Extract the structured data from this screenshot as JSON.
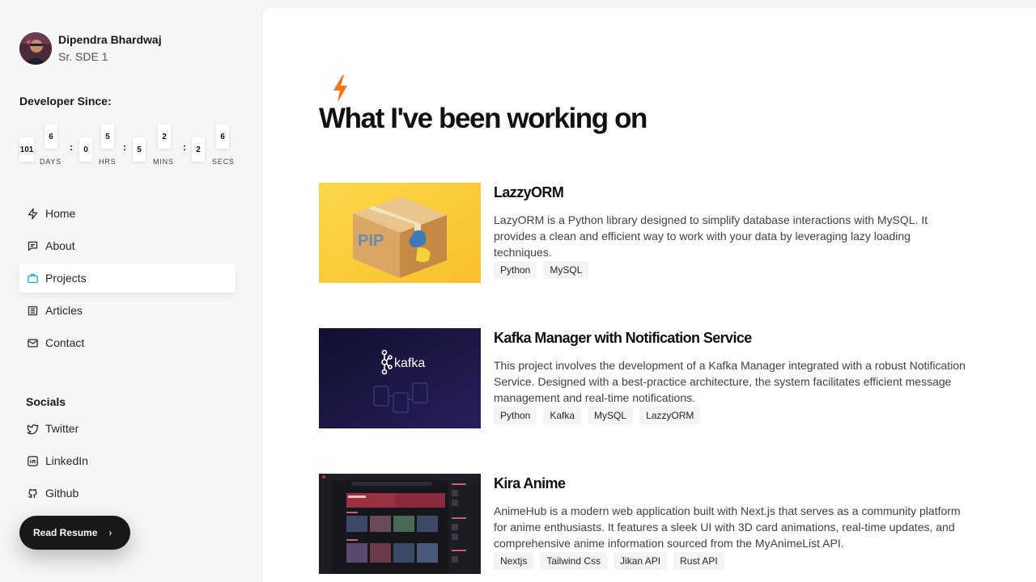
{
  "profile": {
    "name": "Dipendra Bhardwaj",
    "role": "Sr. SDE 1"
  },
  "developer_since": {
    "title": "Developer Since:",
    "days": {
      "value": "101",
      "top": "6",
      "label": "DAYS"
    },
    "hrs": {
      "value": "0",
      "top": "5",
      "label": "HRS"
    },
    "mins": {
      "value": "5",
      "top": "2",
      "label": "MINS"
    },
    "secs": {
      "value": "2",
      "top": "6",
      "label": "SECS"
    },
    "separator": ":"
  },
  "nav": {
    "items": [
      {
        "label": "Home",
        "icon": "bolt-icon"
      },
      {
        "label": "About",
        "icon": "chat-icon"
      },
      {
        "label": "Projects",
        "icon": "briefcase-icon",
        "active": true
      },
      {
        "label": "Articles",
        "icon": "newspaper-icon"
      },
      {
        "label": "Contact",
        "icon": "mail-icon"
      }
    ]
  },
  "socials": {
    "title": "Socials",
    "items": [
      {
        "label": "Twitter",
        "icon": "twitter-icon"
      },
      {
        "label": "LinkedIn",
        "icon": "linkedin-icon"
      },
      {
        "label": "Github",
        "icon": "github-icon"
      }
    ]
  },
  "resume": {
    "label": "Read Resume",
    "chevron": "›"
  },
  "main": {
    "title": "What I've been working on",
    "accent": "#f97316"
  },
  "projects": [
    {
      "title": "LazzyORM",
      "thumb_text": "PIP",
      "description": "LazyORM is a Python library designed to simplify database interactions with MySQL. It provides a clean and efficient way to work with your data by leveraging lazy loading techniques.",
      "tags": [
        "Python",
        "MySQL"
      ]
    },
    {
      "title": "Kafka Manager with Notification Service",
      "thumb_text": "kafka",
      "description": "This project involves the development of a Kafka Manager integrated with a robust Notification Service. Designed with a best-practice architecture, the system facilitates efficient message management and real-time notifications.",
      "tags": [
        "Python",
        "Kafka",
        "MySQL",
        "LazzyORM"
      ]
    },
    {
      "title": "Kira Anime",
      "thumb_text": "",
      "description": "AnimeHub is a modern web application built with Next.js that serves as a community platform for anime enthusiasts. It features a sleek UI with 3D card animations, real-time updates, and comprehensive anime information sourced from the MyAnimeList API.",
      "tags": [
        "Nextjs",
        "Tailwind Css",
        "Jikan API",
        "Rust API"
      ]
    }
  ]
}
